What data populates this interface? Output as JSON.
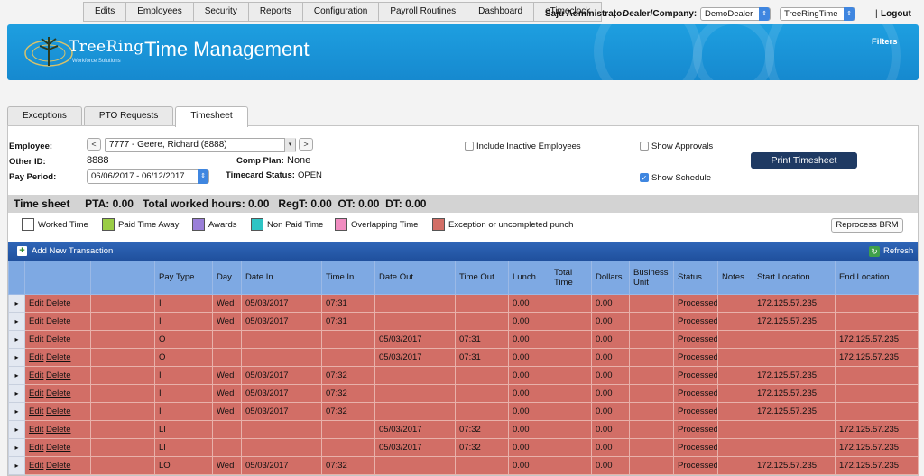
{
  "topnav": {
    "items": [
      "Edits",
      "Employees",
      "Security",
      "Reports",
      "Configuration",
      "Payroll Routines",
      "Dashboard",
      "eTimeclock"
    ],
    "user": "Saju Administrator",
    "dealer_label": "Dealer/Company:",
    "dealer_value": "DemoDealer",
    "company_value": "TreeRingTime",
    "logout": "Logout",
    "separator": "|"
  },
  "banner": {
    "logo_text": "TreeRing",
    "logo_sub": "Workforce Solutions",
    "title": "Time Management",
    "filters": "Filters",
    "color": "#1e9fe0"
  },
  "tabs": [
    "Exceptions",
    "PTO Requests",
    "Timesheet"
  ],
  "form": {
    "employee_label": "Employee:",
    "employee_value": "7777 - Geere, Richard (8888)",
    "prev": "<",
    "next": ">",
    "other_id_label": "Other ID:",
    "other_id_value": "8888",
    "comp_plan_label": "Comp Plan:",
    "comp_plan_value": "None",
    "pay_period_label": "Pay Period:",
    "pay_period_value": "06/06/2017 - 06/12/2017",
    "timecard_status_label": "Timecard Status:",
    "timecard_status_value": "OPEN",
    "include_inactive": "Include Inactive Employees",
    "show_approvals": "Show Approvals",
    "show_schedule": "Show Schedule",
    "print_button": "Print Timesheet"
  },
  "summary": "Time sheet     PTA: 0.00   Total worked hours: 0.00   RegT: 0.00  OT: 0.00  DT: 0.00",
  "legend": [
    {
      "label": "Worked Time",
      "color": "#ffffff"
    },
    {
      "label": "Paid Time Away",
      "color": "#9acd45"
    },
    {
      "label": "Awards",
      "color": "#9a7fd8"
    },
    {
      "label": "Non Paid Time",
      "color": "#2ec4c4"
    },
    {
      "label": "Overlapping Time",
      "color": "#f08cc0"
    },
    {
      "label": "Exception or uncompleted punch",
      "color": "#d26e66"
    }
  ],
  "reprocess": "Reprocess BRM",
  "grid": {
    "add_label": "Add New Transaction",
    "refresh_label": "Refresh",
    "columns": [
      "",
      "",
      "",
      "Pay Type",
      "Day",
      "Date In",
      "Time In",
      "Date Out",
      "Time Out",
      "Lunch",
      "Total Time",
      "Dollars",
      "Business Unit",
      "Status",
      "Notes",
      "Start Location",
      "End Location"
    ],
    "edit": "Edit",
    "delete": "Delete",
    "expander": "▸",
    "rows": [
      {
        "pay_type": "I",
        "day": "Wed",
        "date_in": "05/03/2017",
        "time_in": "07:31",
        "date_out": "",
        "time_out": "",
        "lunch": "0.00",
        "total": "",
        "dollars": "0.00",
        "bu": "",
        "status": "Processed",
        "notes": "",
        "start_loc": "172.125.57.235",
        "end_loc": ""
      },
      {
        "pay_type": "I",
        "day": "Wed",
        "date_in": "05/03/2017",
        "time_in": "07:31",
        "date_out": "",
        "time_out": "",
        "lunch": "0.00",
        "total": "",
        "dollars": "0.00",
        "bu": "",
        "status": "Processed",
        "notes": "",
        "start_loc": "172.125.57.235",
        "end_loc": ""
      },
      {
        "pay_type": "O",
        "day": "",
        "date_in": "",
        "time_in": "",
        "date_out": "05/03/2017",
        "time_out": "07:31",
        "lunch": "0.00",
        "total": "",
        "dollars": "0.00",
        "bu": "",
        "status": "Processed",
        "notes": "",
        "start_loc": "",
        "end_loc": "172.125.57.235"
      },
      {
        "pay_type": "O",
        "day": "",
        "date_in": "",
        "time_in": "",
        "date_out": "05/03/2017",
        "time_out": "07:31",
        "lunch": "0.00",
        "total": "",
        "dollars": "0.00",
        "bu": "",
        "status": "Processed",
        "notes": "",
        "start_loc": "",
        "end_loc": "172.125.57.235"
      },
      {
        "pay_type": "I",
        "day": "Wed",
        "date_in": "05/03/2017",
        "time_in": "07:32",
        "date_out": "",
        "time_out": "",
        "lunch": "0.00",
        "total": "",
        "dollars": "0.00",
        "bu": "",
        "status": "Processed",
        "notes": "",
        "start_loc": "172.125.57.235",
        "end_loc": ""
      },
      {
        "pay_type": "I",
        "day": "Wed",
        "date_in": "05/03/2017",
        "time_in": "07:32",
        "date_out": "",
        "time_out": "",
        "lunch": "0.00",
        "total": "",
        "dollars": "0.00",
        "bu": "",
        "status": "Processed",
        "notes": "",
        "start_loc": "172.125.57.235",
        "end_loc": ""
      },
      {
        "pay_type": "I",
        "day": "Wed",
        "date_in": "05/03/2017",
        "time_in": "07:32",
        "date_out": "",
        "time_out": "",
        "lunch": "0.00",
        "total": "",
        "dollars": "0.00",
        "bu": "",
        "status": "Processed",
        "notes": "",
        "start_loc": "172.125.57.235",
        "end_loc": ""
      },
      {
        "pay_type": "LI",
        "day": "",
        "date_in": "",
        "time_in": "",
        "date_out": "05/03/2017",
        "time_out": "07:32",
        "lunch": "0.00",
        "total": "",
        "dollars": "0.00",
        "bu": "",
        "status": "Processed",
        "notes": "",
        "start_loc": "",
        "end_loc": "172.125.57.235"
      },
      {
        "pay_type": "LI",
        "day": "",
        "date_in": "",
        "time_in": "",
        "date_out": "05/03/2017",
        "time_out": "07:32",
        "lunch": "0.00",
        "total": "",
        "dollars": "0.00",
        "bu": "",
        "status": "Processed",
        "notes": "",
        "start_loc": "",
        "end_loc": "172.125.57.235"
      },
      {
        "pay_type": "LO",
        "day": "Wed",
        "date_in": "05/03/2017",
        "time_in": "07:32",
        "date_out": "",
        "time_out": "",
        "lunch": "0.00",
        "total": "",
        "dollars": "0.00",
        "bu": "",
        "status": "Processed",
        "notes": "",
        "start_loc": "172.125.57.235",
        "end_loc": "172.125.57.235"
      }
    ]
  }
}
